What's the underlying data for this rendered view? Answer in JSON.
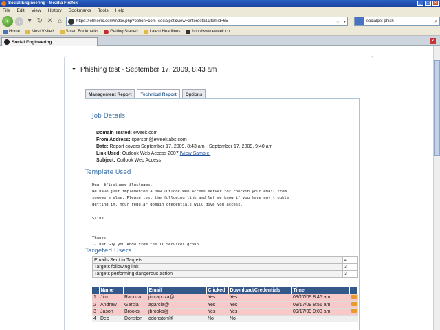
{
  "window": {
    "title": "Social Engineering - Mozilla Firefox"
  },
  "menu": [
    "File",
    "Edit",
    "View",
    "History",
    "Bookmarks",
    "Tools",
    "Help"
  ],
  "navigation": {
    "url": "https://jetmeinc.com/index.php?option=com_socialpet&view=enterdetail&itemid=65",
    "search_value": "socialpet phish"
  },
  "bookmarks": [
    "Home",
    "Most Visited",
    "Smart Bookmarks",
    "Getting Started",
    "Latest Headlines",
    "http://www.eweek.co.."
  ],
  "tab": {
    "label": "Social Engineering"
  },
  "panel": {
    "title": "Phishing test - September 17, 2009, 8:43 am",
    "tabs": [
      "Management Report",
      "Technical Report",
      "Options"
    ]
  },
  "job": {
    "heading": "Job Details",
    "domain_label": "Domain Tested:",
    "domain_value": "eweek.com",
    "from_label": "From Address:",
    "from_value": "itperson@eweeklabs.com",
    "date_label": "Date:",
    "date_value": "Report covers September 17, 2009, 8:43 am - September 17, 2009, 9:40 am",
    "link_label": "Link Used:",
    "link_value": "Outlook Web Access 2007",
    "link_sample": "[View Sample]",
    "subject_label": "Subject:",
    "subject_value": "Outlook Web Access"
  },
  "template": {
    "heading": "Template Used",
    "body": "Dear $firstname $lastname,\nWe have just implemented a new Outlook Web Access server for checkin your email from\nsomewere else. Please test the following link and let me know if you have any trouble\ngetting in. Your regular domain credentials will give you access.\n\n$link\n\n\nThanks,\n--That Guy you know from the IT Services group"
  },
  "targeted": {
    "heading": "Targeted Users",
    "summary": [
      {
        "label": "Emails Sent to Targets",
        "value": "4"
      },
      {
        "label": "Targets following link",
        "value": "3"
      },
      {
        "label": "Targets performing dangerous action",
        "value": "3"
      }
    ],
    "columns": [
      "Name",
      "",
      "Email",
      "Clicked",
      "Download/Credentials",
      "Time"
    ],
    "rows": [
      {
        "num": "1",
        "first": "Jim",
        "last": "Rapoza",
        "email": "jimrapoza@",
        "clicked": "Yes",
        "download": "Yes",
        "time": "09/17/09 8:46 am"
      },
      {
        "num": "2",
        "first": "Andrew",
        "last": "Garcia",
        "email": "agarcia@",
        "clicked": "Yes",
        "download": "Yes",
        "time": "09/17/09 8:51 am"
      },
      {
        "num": "3",
        "first": "Jason",
        "last": "Brooks",
        "email": "jbrooks@",
        "clicked": "Yes",
        "download": "Yes",
        "time": "09/17/09 9:00 am"
      },
      {
        "num": "4",
        "first": "Deb",
        "last": "Donston",
        "email": "ddonston@",
        "clicked": "No",
        "download": "No",
        "time": ""
      }
    ]
  },
  "colors": {
    "accent": "#3a6fa3",
    "table_header": "#34588a",
    "hit_row": "#f7c9c9"
  }
}
